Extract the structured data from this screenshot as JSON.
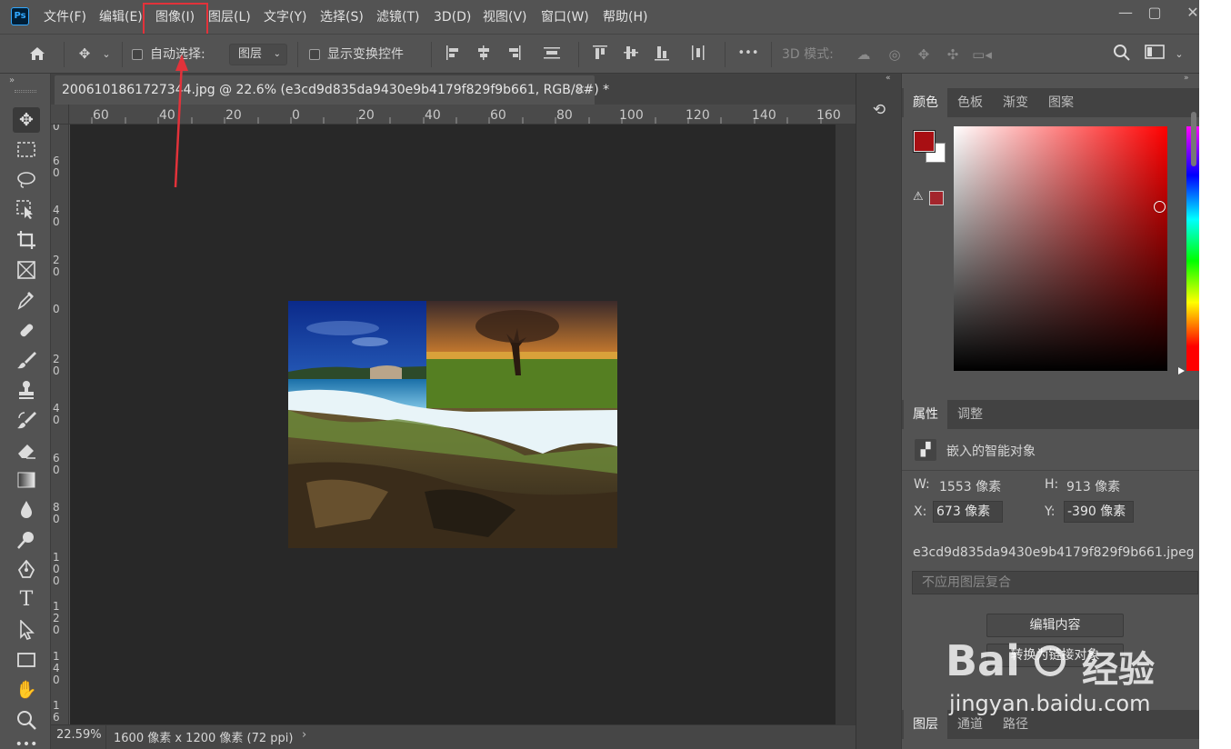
{
  "app": {
    "logo": "Ps"
  },
  "menus": [
    "文件(F)",
    "编辑(E)",
    "图像(I)",
    "图层(L)",
    "文字(Y)",
    "选择(S)",
    "滤镜(T)",
    "3D(D)",
    "视图(V)",
    "窗口(W)",
    "帮助(H)"
  ],
  "window_controls": {
    "minimize": "—",
    "restore": "▢",
    "close": "✕"
  },
  "options_bar": {
    "auto_select_label": "自动选择:",
    "auto_select_value": "图层",
    "show_transform_label": "显示变换控件",
    "more": "•••",
    "mode_3d_label": "3D 模式:"
  },
  "document": {
    "tab_title": "2006101861727344.jpg @ 22.6% (e3cd9d835da9430e9b4179f829f9b661, RGB/8#) *",
    "close": "×"
  },
  "ruler_h_labels": [
    "60",
    "40",
    "20",
    "0",
    "20",
    "40",
    "60",
    "80",
    "100",
    "120",
    "140",
    "160"
  ],
  "ruler_v_labels": [
    "0",
    "6\n0",
    "4\n0",
    "2\n0",
    "0",
    "2\n0",
    "4\n0",
    "6\n0",
    "8\n0",
    "1\n0\n0",
    "1\n2\n0",
    "1\n4\n0",
    "1\n6"
  ],
  "status": {
    "zoom": "22.59%",
    "doc_size": "1600 像素 x 1200 像素 (72 ppi)",
    "arrow": "›"
  },
  "color_panel": {
    "tabs": [
      "颜色",
      "色板",
      "渐变",
      "图案"
    ],
    "foreground": "#a80f13",
    "background": "#ffffff",
    "gamut_swatch": "#a3252c"
  },
  "properties_panel": {
    "tabs": [
      "属性",
      "调整"
    ],
    "object_type": "嵌入的智能对象",
    "w_label": "W:",
    "w_value": "1553 像素",
    "h_label": "H:",
    "h_value": "913 像素",
    "x_label": "X:",
    "x_value": "673 像素",
    "y_label": "Y:",
    "y_value": "-390 像素",
    "filename": "e3cd9d835da9430e9b4179f829f9b661.jpeg",
    "comp_select": "不应用图层复合",
    "edit_contents": "编辑内容",
    "convert_linked": "转换为链接对象"
  },
  "layers_panel": {
    "tabs": [
      "图层",
      "通道",
      "路径"
    ]
  },
  "watermark": {
    "brand": "Bai",
    "brand2": "经验",
    "url": "jingyan.baidu.com"
  }
}
